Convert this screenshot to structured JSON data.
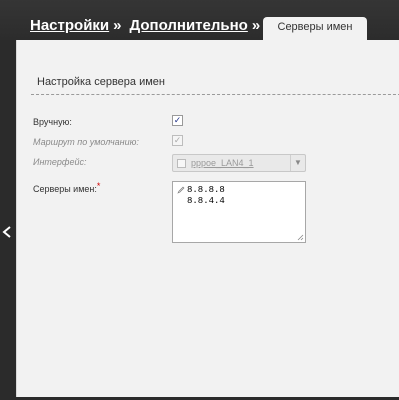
{
  "breadcrumb": {
    "items": [
      "Настройки",
      "Дополнительно"
    ],
    "separator": "»"
  },
  "tab": {
    "label": "Серверы имен"
  },
  "section": {
    "title": "Настройка сервера имен"
  },
  "form": {
    "manual": {
      "label": "Вручную:",
      "checked": true
    },
    "default_route": {
      "label": "Маршрут по умолчанию:",
      "checked": true,
      "disabled": true
    },
    "interface": {
      "label": "Интерфейс:",
      "value": "pppoe_LAN4_1",
      "disabled": true
    },
    "name_servers": {
      "label": "Серверы имен:",
      "required_mark": "*",
      "values": [
        "8.8.8.8",
        "8.8.4.4"
      ]
    }
  },
  "icons": {
    "collapse": "chevron-left-icon",
    "edit": "pencil-icon",
    "resize": "resize-grip-icon",
    "dropdown": "chevron-down-icon"
  },
  "colors": {
    "background": "#2b2b2b",
    "panel": "#f2f2f2",
    "required": "#d00000",
    "checkmark": "#223388"
  }
}
